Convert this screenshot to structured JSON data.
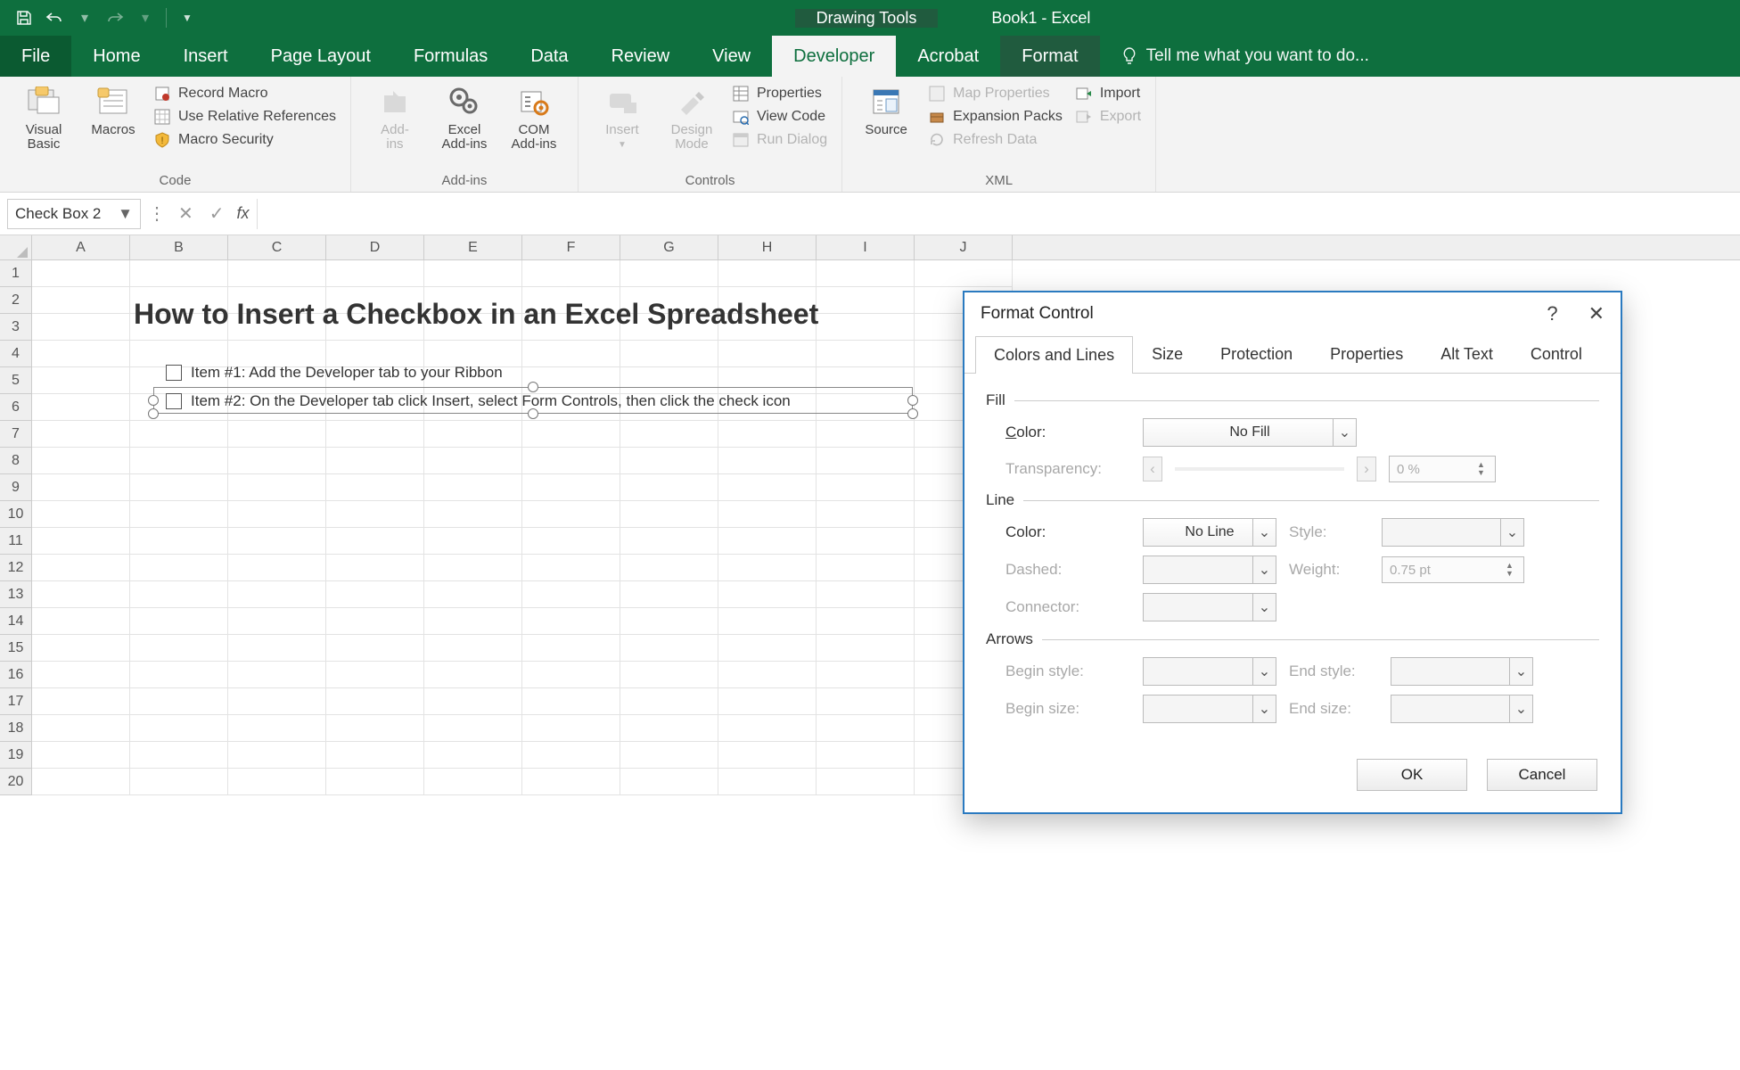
{
  "titlebar": {
    "context_tab": "Drawing Tools",
    "book_title": "Book1 - Excel"
  },
  "tabs": {
    "file": "File",
    "home": "Home",
    "insert": "Insert",
    "page_layout": "Page Layout",
    "formulas": "Formulas",
    "data": "Data",
    "review": "Review",
    "view": "View",
    "developer": "Developer",
    "acrobat": "Acrobat",
    "format": "Format",
    "tell_me": "Tell me what you want to do..."
  },
  "ribbon": {
    "code": {
      "visual_basic": "Visual\nBasic",
      "macros": "Macros",
      "record_macro": "Record Macro",
      "use_relative": "Use Relative References",
      "macro_security": "Macro Security",
      "group": "Code"
    },
    "addins": {
      "addins": "Add-\nins",
      "excel_addins": "Excel\nAdd-ins",
      "com_addins": "COM\nAdd-ins",
      "group": "Add-ins"
    },
    "controls": {
      "insert": "Insert",
      "design_mode": "Design\nMode",
      "properties": "Properties",
      "view_code": "View Code",
      "run_dialog": "Run Dialog",
      "group": "Controls"
    },
    "xml": {
      "source": "Source",
      "map_properties": "Map Properties",
      "expansion_packs": "Expansion Packs",
      "refresh_data": "Refresh Data",
      "import": "Import",
      "export": "Export",
      "group": "XML"
    }
  },
  "formula_bar": {
    "name_box": "Check Box 2",
    "fx": "fx"
  },
  "grid": {
    "columns": [
      "A",
      "B",
      "C",
      "D",
      "E",
      "F",
      "G",
      "H",
      "I",
      "J"
    ],
    "rows": [
      "1",
      "2",
      "3",
      "4",
      "5",
      "6",
      "7",
      "8",
      "9",
      "10",
      "11",
      "12",
      "13",
      "14",
      "15",
      "16",
      "17",
      "18",
      "19",
      "20"
    ]
  },
  "sheet": {
    "title": "How to Insert a Checkbox in an Excel Spreadsheet",
    "item1": "Item #1: Add the Developer tab to your Ribbon",
    "item2": "Item #2: On the Developer tab click Insert, select Form Controls, then click the check icon"
  },
  "dialog": {
    "title": "Format Control",
    "tabs": {
      "colors": "Colors and Lines",
      "size": "Size",
      "protection": "Protection",
      "properties": "Properties",
      "alt_text": "Alt Text",
      "control": "Control"
    },
    "fill": {
      "section": "Fill",
      "color_label": "Color:",
      "color_value": "No Fill",
      "transparency_label": "Transparency:",
      "transparency_value": "0 %"
    },
    "line": {
      "section": "Line",
      "color_label": "Color:",
      "color_value": "No Line",
      "style_label": "Style:",
      "dashed_label": "Dashed:",
      "weight_label": "Weight:",
      "weight_value": "0.75 pt",
      "connector_label": "Connector:"
    },
    "arrows": {
      "section": "Arrows",
      "begin_style": "Begin style:",
      "end_style": "End style:",
      "begin_size": "Begin size:",
      "end_size": "End size:"
    },
    "ok": "OK",
    "cancel": "Cancel"
  }
}
